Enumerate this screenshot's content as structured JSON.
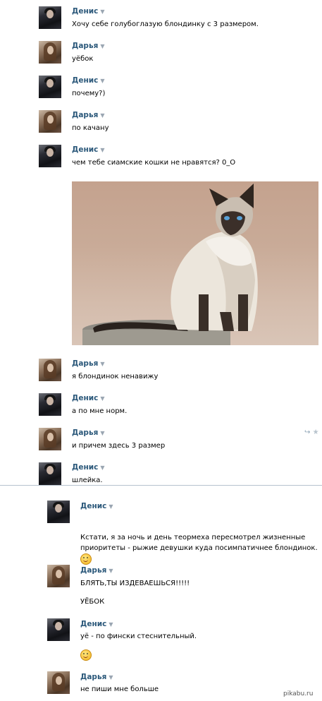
{
  "messages_old": [
    {
      "author": "Денис",
      "avatar": "denis",
      "text": "Хочу себе голубоглазую блондинку с 3 размером."
    },
    {
      "author": "Дарья",
      "avatar": "daria",
      "text": "уёбок"
    },
    {
      "author": "Денис",
      "avatar": "denis",
      "text": "почему?)"
    },
    {
      "author": "Дарья",
      "avatar": "daria",
      "text": "по качану"
    },
    {
      "author": "Денис",
      "avatar": "denis",
      "text": "чем тебе сиамские кошки не нравятся? 0_О"
    },
    {
      "author": "Дарья",
      "avatar": "daria",
      "text": "я блондинок ненавижу"
    },
    {
      "author": "Денис",
      "avatar": "denis",
      "text": "а по мне норм."
    },
    {
      "author": "Дарья",
      "avatar": "daria",
      "text": "и причем здесь 3 размер"
    },
    {
      "author": "Денис",
      "avatar": "denis",
      "text": "шлейка."
    }
  ],
  "messages_new": [
    {
      "author": "Денис",
      "avatar": "denis",
      "text": "Кстати, я за ночь и день теормеха пересмотрел жизненные приоритеты - рыжие девушки куда посимпатичнее блондинок.",
      "emoji": "wink-smiley-icon"
    },
    {
      "author": "Дарья",
      "avatar": "daria",
      "text": "БЛЯТЬ,ТЫ ИЗДЕВАЕШЬСЯ!!!!!",
      "text2": "УЁБОК"
    },
    {
      "author": "Денис",
      "avatar": "denis",
      "text": "уё - по фински стеснительный.",
      "emoji": "smile-smiley-icon"
    },
    {
      "author": "Дарья",
      "avatar": "daria",
      "text": "не пиши мне больше"
    }
  ],
  "caret_glyph": "▼",
  "watermark": "pikabu.ru",
  "colors": {
    "author_name": "#2b587a",
    "divider": "#b7c2ce"
  }
}
